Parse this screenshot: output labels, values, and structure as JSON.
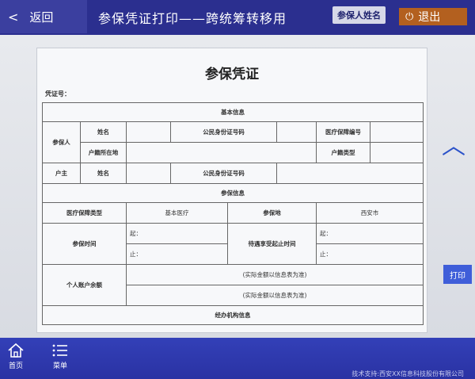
{
  "header": {
    "back_label": "返回",
    "title": "参保凭证打印——跨统筹转移用",
    "name_badge": "参保人姓名",
    "exit_label": "退出"
  },
  "document": {
    "title": "参保凭证",
    "cert_no_label": "凭证号：",
    "basic_info": "基本信息",
    "insured_person": "参保人",
    "name_label": "姓名",
    "id_number_label": "公民身份证号码",
    "medical_no_label": "医疗保障编号",
    "hukou_location_label": "户籍所在地",
    "hukou_type_label": "户籍类型",
    "household_head": "户主",
    "head_name_label": "姓名",
    "head_id_label": "公民身份证号码",
    "insurance_info": "参保信息",
    "medical_type_label": "医疗保障类型",
    "medical_type_value": "基本医疗",
    "insured_place_label": "参保地",
    "insured_place_value": "西安市",
    "insured_period_label": "参保时间",
    "start_label": "起：",
    "end_label": "止：",
    "waiting_period_label": "待遇享受起止时间",
    "balance_label": "个人账户余额",
    "balance_note_1": "(实际金额以信息表为准)",
    "balance_note_2": "(实际金额以信息表为准)",
    "agency_info": "经办机构信息"
  },
  "side": {
    "print_label": "打印"
  },
  "footer": {
    "home_label": "首页",
    "menu_label": "菜单",
    "copyright": "技术支持:西安XX信息科技股份有限公司"
  },
  "colors": {
    "topbar": "#2b2f8f",
    "exit": "#b3601f",
    "bottombar": "#2a32a3",
    "print": "#3f5ed9"
  }
}
